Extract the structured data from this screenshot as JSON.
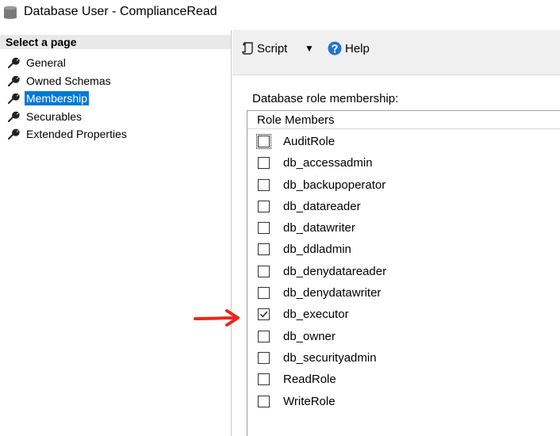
{
  "window": {
    "title": "Database User - ComplianceRead",
    "icon": "database-icon"
  },
  "left_pane": {
    "header": "Select a page",
    "items": [
      {
        "label": "General",
        "icon": "wrench-icon",
        "selected": false
      },
      {
        "label": "Owned Schemas",
        "icon": "wrench-icon",
        "selected": false
      },
      {
        "label": "Membership",
        "icon": "wrench-icon",
        "selected": true
      },
      {
        "label": "Securables",
        "icon": "wrench-icon",
        "selected": false
      },
      {
        "label": "Extended Properties",
        "icon": "wrench-icon",
        "selected": false
      }
    ]
  },
  "toolbar": {
    "script_label": "Script",
    "help_label": "Help"
  },
  "membership": {
    "group_label": "Database role membership:",
    "column_header": "Role Members",
    "roles": [
      {
        "name": "AuditRole",
        "checked": false
      },
      {
        "name": "db_accessadmin",
        "checked": false
      },
      {
        "name": "db_backupoperator",
        "checked": false
      },
      {
        "name": "db_datareader",
        "checked": false
      },
      {
        "name": "db_datawriter",
        "checked": false
      },
      {
        "name": "db_ddladmin",
        "checked": false
      },
      {
        "name": "db_denydatareader",
        "checked": false
      },
      {
        "name": "db_denydatawriter",
        "checked": false
      },
      {
        "name": "db_executor",
        "checked": true
      },
      {
        "name": "db_owner",
        "checked": false
      },
      {
        "name": "db_securityadmin",
        "checked": false
      },
      {
        "name": "ReadRole",
        "checked": false
      },
      {
        "name": "WriteRole",
        "checked": false
      }
    ]
  },
  "colors": {
    "selection": "#0078d7",
    "annotation_arrow": "#e8281e",
    "help_icon": "#1e74d0"
  }
}
